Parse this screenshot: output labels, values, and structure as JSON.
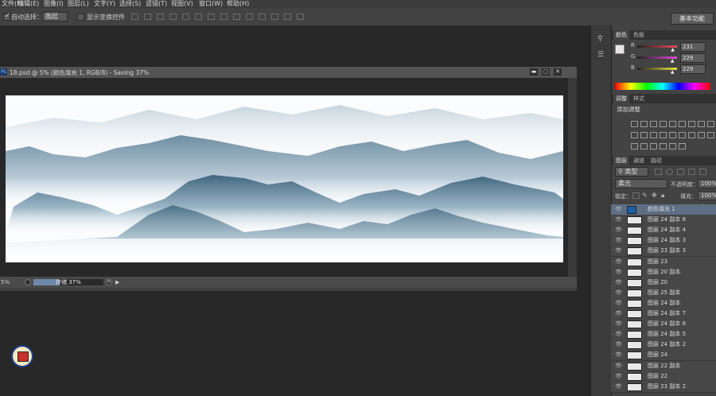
{
  "menu": [
    "文件(F)",
    "编辑(E)",
    "图像(I)",
    "图层(L)",
    "文字(Y)",
    "选择(S)",
    "滤镜(T)",
    "视图(V)",
    "窗口(W)",
    "帮助(H)"
  ],
  "options": {
    "auto_select_label": "自动选择：",
    "auto_select_value": "图层",
    "transform_label": "显示变换控件",
    "workspace": "基本功能"
  },
  "document": {
    "title": "18.psd @ 5% (颜色填充 1, RGB/8) - Saving 37%",
    "ps_badge": "Ps",
    "zoom": "5%",
    "progress_label": "存储 37%",
    "progress": 0.37
  },
  "color_panel": {
    "tabs": [
      "颜色",
      "色板"
    ],
    "channels": [
      {
        "label": "R",
        "value": "231",
        "color": "#e74c5a"
      },
      {
        "label": "G",
        "value": "229",
        "color": "#e04ad8"
      },
      {
        "label": "B",
        "value": "229",
        "color": "#e8e23a"
      }
    ],
    "foreground": "#e7e5e5",
    "background": "#000000"
  },
  "adjust_panel": {
    "tabs": [
      "调整",
      "样式"
    ],
    "title": "添加调整"
  },
  "layers_panel": {
    "tabs": [
      "图层",
      "通道",
      "路径"
    ],
    "filter": "类型",
    "blend_mode": "柔光",
    "opacity_label": "不透明度：",
    "opacity": "100%",
    "lock_label": "锁定：",
    "fill_label": "填充：",
    "fill": "100%",
    "layers": [
      "颜色填充 1",
      "图层 24 副本 8",
      "图层 24 副本 4",
      "图层 24 副本 3",
      "图层 23 副本 3",
      "图层 23",
      "图层 20 副本",
      "图层 20",
      "图层 25 副本",
      "图层 24 副本",
      "图层 24 副本 7",
      "图层 24 副本 6",
      "图层 24 副本 5",
      "图层 24 副本 2",
      "图层 24",
      "图层 22 副本",
      "图层 22",
      "图层 23 副本 2"
    ]
  }
}
